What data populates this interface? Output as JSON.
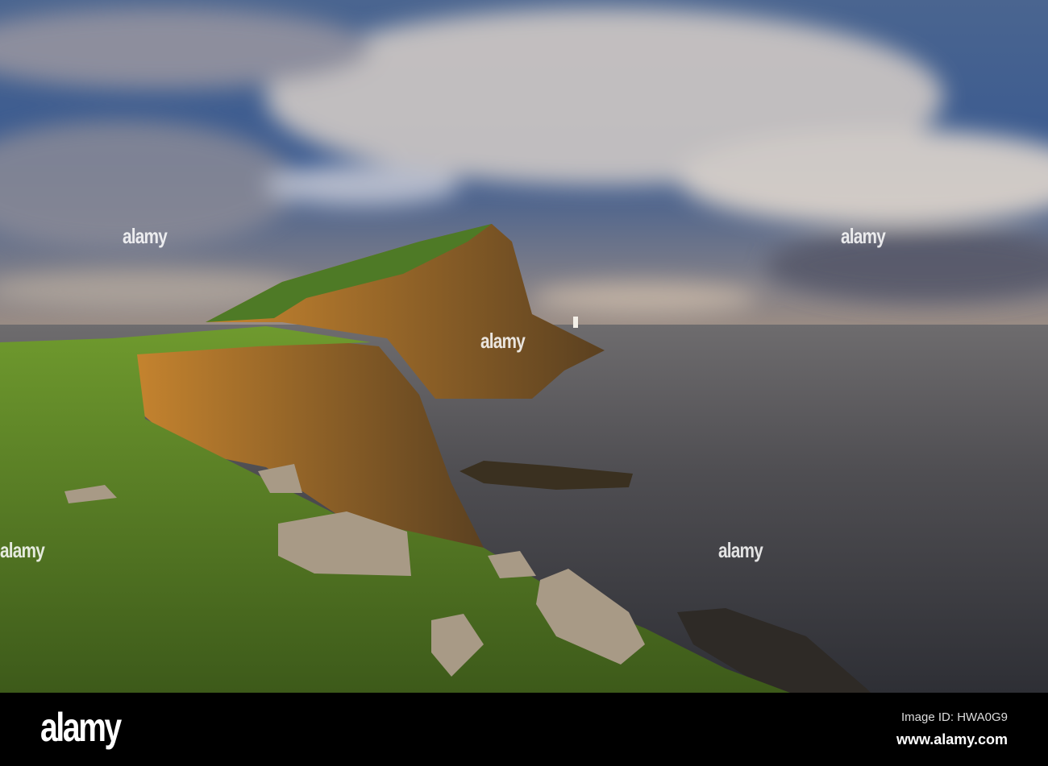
{
  "image": {
    "subject": "Neist Point lighthouse cliffs at sunset",
    "colors": {
      "sky_top": "#3d5c8a",
      "cloud": "#e8ddd0",
      "sea": "#4a4a4e",
      "cliff": "#b5752e",
      "grass": "#5f8a2a"
    }
  },
  "watermark": {
    "text": "alamy"
  },
  "footer": {
    "logo": "alamy",
    "image_id": "Image ID: HWA0G9",
    "website": "www.alamy.com"
  }
}
